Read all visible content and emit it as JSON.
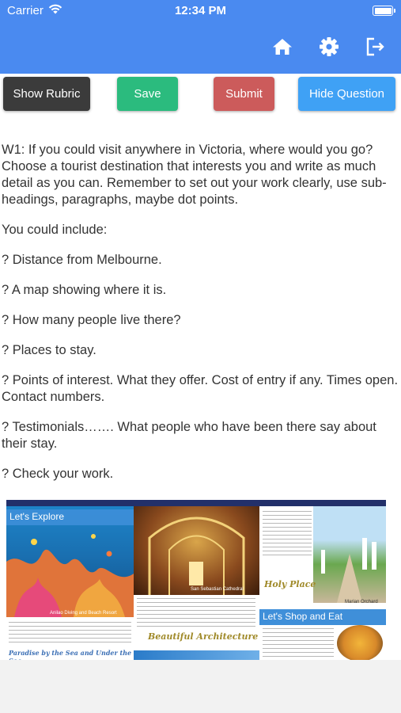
{
  "status_bar": {
    "carrier": "Carrier",
    "time": "12:34 PM"
  },
  "nav": {
    "icons": [
      "home-icon",
      "gear-icon",
      "logout-icon"
    ]
  },
  "toolbar": {
    "show_rubric": "Show Rubric",
    "save": "Save",
    "submit": "Submit",
    "hide_question": "Hide Question"
  },
  "colors": {
    "header": "#4a8af0",
    "rubric_button": "#3b3b3b",
    "save_button": "#2bbb7e",
    "submit_button": "#cc5b5b",
    "hide_button": "#3fa1f5"
  },
  "question": {
    "prompt": "W1: If you could visit anywhere in Victoria, where would you go? Choose a tourist destination that interests you and write as much detail as you can. Remember to set out your work clearly, use sub-headings, paragraphs, maybe dot points.",
    "intro": "You could include:",
    "items": [
      "? Distance from Melbourne.",
      "? A map showing where it is.",
      "? How many people live there?",
      "? Places to stay.",
      "? Points of interest. What they offer. Cost of entry if any. Times open. Contact numbers.",
      "? Testimonials……. What people who have been there say about their stay.",
      "? Check your work."
    ]
  },
  "brochure": {
    "lets_explore": "Let's Explore",
    "dive_caption": "Anilao Diving and Beach Resort",
    "paradise": "Paradise by the Sea and Under the Sea.",
    "cathedral_caption": "San Sebastian Cathedral",
    "beautiful_architecture": "Beautiful Architecture",
    "holy_place": "Holy Place",
    "orchard_caption": "Marian Orchard",
    "lets_shop": "Let's Shop and Eat"
  }
}
